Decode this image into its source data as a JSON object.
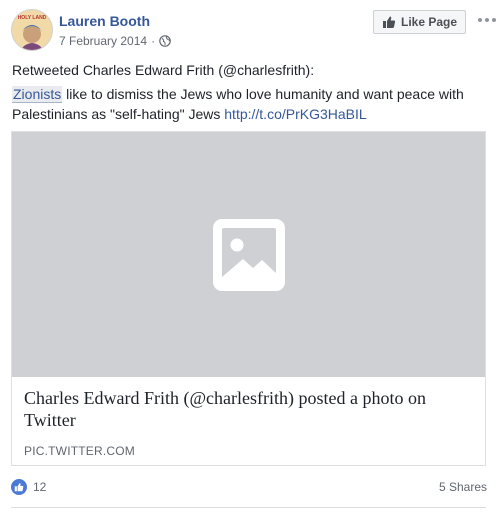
{
  "post": {
    "author": "Lauren Booth",
    "date": "7 February 2014",
    "separator": "·",
    "privacy_icon": "globe-icon",
    "like_page_label": "Like Page",
    "avatar_text": "HOLY LAND",
    "line1": "Retweeted Charles Edward Frith (@charlesfrith):",
    "hashword": "Zionists",
    "line2_rest": " like to dismiss the Jews who love humanity and want peace with Palestinians as \"self-hating\" Jews ",
    "link": "http://t.co/PrKG3HaBIL"
  },
  "attachment": {
    "title": "Charles Edward Frith (@charlesfrith) posted a photo on Twitter",
    "domain": "PIC.TWITTER.COM",
    "image_icon": "image-placeholder-icon"
  },
  "footer": {
    "reaction_count": "12",
    "shares": "5 Shares"
  },
  "colors": {
    "brand_blue": "#365899",
    "like_blue": "#4b79d6",
    "placeholder_gray": "#ced0d4"
  }
}
